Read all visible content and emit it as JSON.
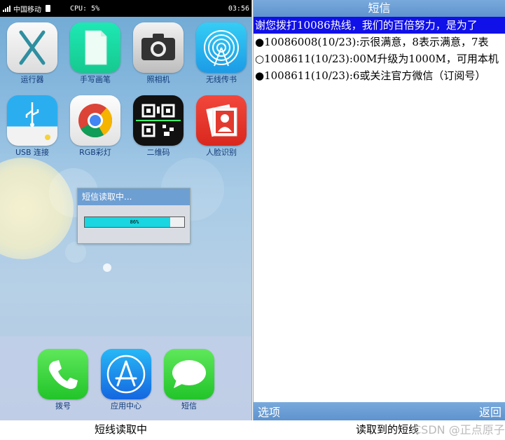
{
  "left_screen": {
    "status_bar": {
      "carrier": "中国移动",
      "cpu": "CPU: 5%",
      "time": "03:56"
    },
    "apps": [
      {
        "label": "运行器",
        "icon": "x-launcher-icon"
      },
      {
        "label": "手写画笔",
        "icon": "document-page-icon"
      },
      {
        "label": "照相机",
        "icon": "camera-icon"
      },
      {
        "label": "无线传书",
        "icon": "wireless-icon"
      },
      {
        "label": "USB 连接",
        "icon": "usb-icon"
      },
      {
        "label": "RGB彩灯",
        "icon": "chrome-rgb-icon"
      },
      {
        "label": "二维码",
        "icon": "qr-code-icon"
      },
      {
        "label": "人脸识别",
        "icon": "face-id-icon"
      }
    ],
    "dialog": {
      "title": "短信读取中...",
      "progress_text": "86%",
      "progress": 0.86
    },
    "dock": [
      {
        "label": "拨号",
        "icon": "phone-icon"
      },
      {
        "label": "应用中心",
        "icon": "app-store-icon"
      },
      {
        "label": "短信",
        "icon": "message-bubble-icon"
      }
    ]
  },
  "right_screen": {
    "header_title": "短信",
    "messages": [
      {
        "text": "谢您拨打10086热线，我们的百倍努力，是为了",
        "selected": true
      },
      {
        "text": "●10086008(10/23):示很满意，8表示满意，7表",
        "selected": false
      },
      {
        "text": "○1008611(10/23):00M升级为1000M，可用本机",
        "selected": false
      },
      {
        "text": "●1008611(10/23):6或关注官方微信（订阅号）",
        "selected": false
      }
    ],
    "softkey_left": "选项",
    "softkey_right": "返回"
  },
  "captions": {
    "left": "短线读取中",
    "right": "读取到的短线"
  },
  "watermark": "CSDN @正点原子",
  "colors": {
    "selection": "#1010e8",
    "header": "#6e9fd3",
    "progress": "#19d6e0",
    "label_text": "#133a78"
  }
}
